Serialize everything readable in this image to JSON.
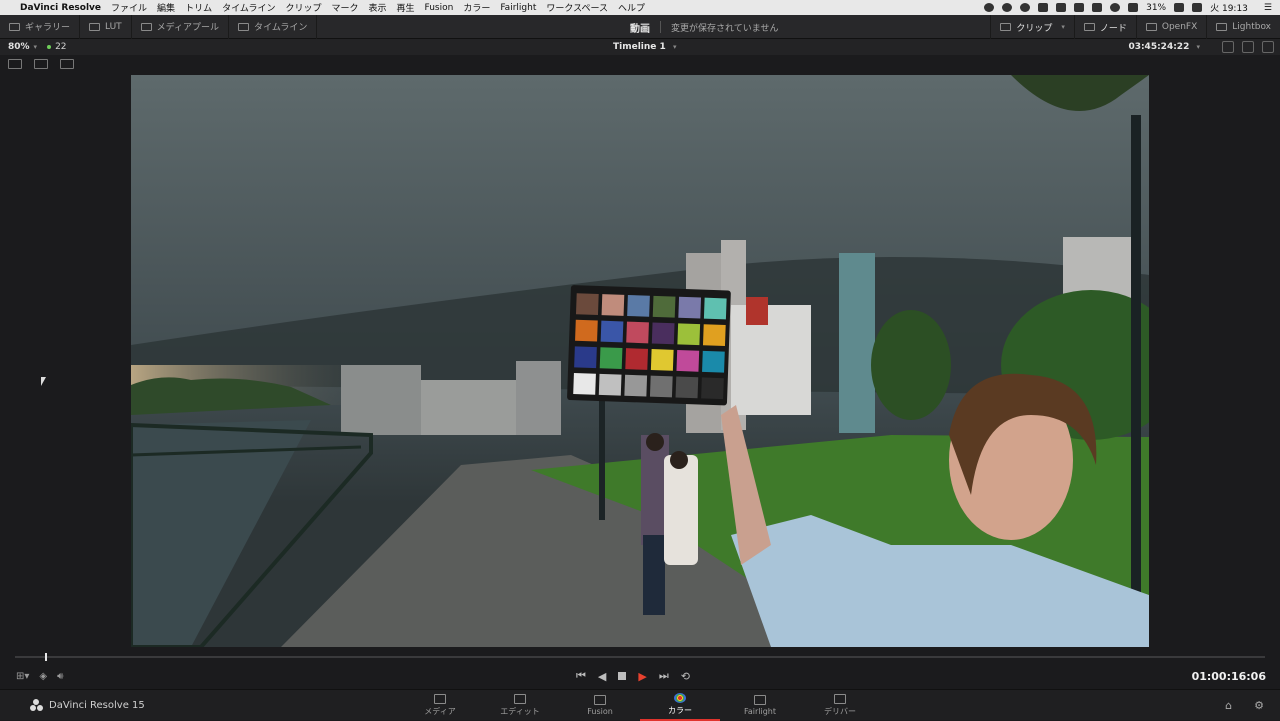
{
  "menubar": {
    "app_name": "DaVinci Resolve",
    "items": [
      "ファイル",
      "編集",
      "トリム",
      "タイムライン",
      "クリップ",
      "マーク",
      "表示",
      "再生",
      "Fusion",
      "カラー",
      "Fairlight",
      "ワークスペース",
      "ヘルプ"
    ],
    "battery": "31%",
    "clock": "火 19:13"
  },
  "toolbar": {
    "gallery": "ギャラリー",
    "lut": "LUT",
    "media_pool": "メディアプール",
    "timeline": "タイムライン",
    "mode": "動画",
    "unsaved": "変更が保存されていません",
    "clip": "クリップ",
    "nodes": "ノード",
    "openfx": "OpenFX",
    "lightbox": "Lightbox"
  },
  "viewer": {
    "zoom": "80%",
    "clip_count": "22",
    "timeline_name": "Timeline 1",
    "source_timecode": "03:45:24:22"
  },
  "transport": {
    "timecode": "01:00:16:06",
    "progress": 0.024
  },
  "pagebar": {
    "brand": "DaVinci Resolve 15",
    "pages": [
      {
        "label": "メディア",
        "icon": "media-page-icon"
      },
      {
        "label": "エディット",
        "icon": "edit-page-icon"
      },
      {
        "label": "Fusion",
        "icon": "fusion-page-icon"
      },
      {
        "label": "カラー",
        "icon": "color-page-icon"
      },
      {
        "label": "Fairlight",
        "icon": "fairlight-page-icon"
      },
      {
        "label": "デリバー",
        "icon": "deliver-page-icon"
      }
    ],
    "active_page": "カラー"
  },
  "colorchecker": {
    "swatches": [
      "#6b4a3c",
      "#c08c7c",
      "#5a7aa6",
      "#4f6b3a",
      "#7a7aaa",
      "#5fc0b0",
      "#d06a1e",
      "#3a56a8",
      "#c04a5e",
      "#4a2e5e",
      "#9cc03a",
      "#e0a020",
      "#2a3a8a",
      "#3a9a4a",
      "#b02a30",
      "#e0c830",
      "#c04a9a",
      "#1a8aaa",
      "#e8e8e8",
      "#c0c0c0",
      "#989898",
      "#707070",
      "#4a4a4a",
      "#2a2a2a"
    ]
  }
}
